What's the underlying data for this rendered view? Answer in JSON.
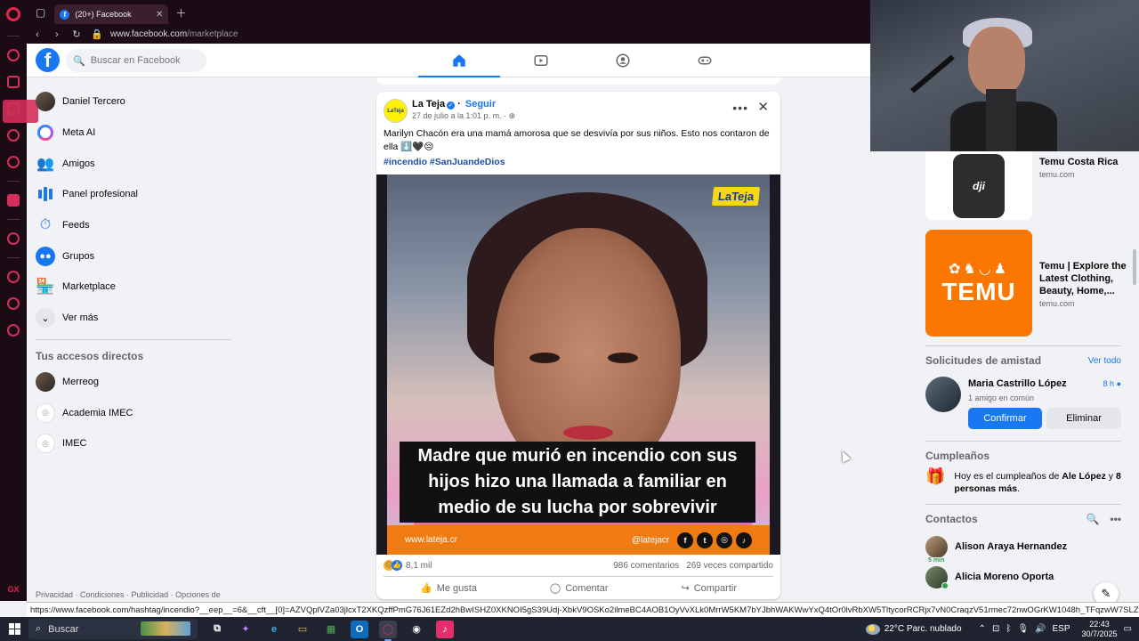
{
  "browser": {
    "tab_title": "(20+) Facebook",
    "url_host": "www.facebook.com",
    "url_path": "/marketplace",
    "status_url": "https://www.facebook.com/hashtag/incendio?__eep__=6&__cft__[0]=AZVQplVZa03jlcxT2XKQzffPmG76J61EZd2hBwISHZ0XKNOI5gS39Udj-XbkV9OSKo2ilmeBC4AOB1OyVvXLk0MrrW5KM7bYJbhWAKWwYxQ4tOr0lvRbXW5TltycorRCRjx7vN0CraqzV51rmec72nwOGrKW1048h_TFqzwW7SLZygS7nXpR..."
  },
  "header": {
    "logo": "f",
    "search_placeholder": "Buscar en Facebook"
  },
  "sidebar": {
    "items": [
      {
        "label": "Daniel Tercero"
      },
      {
        "label": "Meta AI"
      },
      {
        "label": "Amigos"
      },
      {
        "label": "Panel profesional"
      },
      {
        "label": "Feeds"
      },
      {
        "label": "Grupos"
      },
      {
        "label": "Marketplace"
      },
      {
        "label": "Ver más"
      }
    ],
    "shortcuts_title": "Tus accesos directos",
    "shortcuts": [
      {
        "label": "Merreog"
      },
      {
        "label": "Academia IMEC"
      },
      {
        "label": "IMEC"
      }
    ],
    "footer": "Privacidad · Condiciones · Publicidad · Opciones de"
  },
  "post": {
    "page_name": "La Teja",
    "follow": "Seguir",
    "date": "27 de julio a la 1:01 p. m. ·",
    "text": "Marilyn Chacón era una mamá amorosa que se desvivía por sus niños. Esto nos contaron de ella ⬇️🖤😔",
    "hashtags": "#incendio #SanJuandeDios",
    "image": {
      "brand": "LaTeja",
      "caption": "Madre que murió en incendio con sus hijos hizo una llamada a familiar en medio de su lucha por sobrevivir",
      "site": "www.lateja.cr",
      "handle": "@latejacr"
    },
    "reactions_count": "8,1 mil",
    "comments": "986 comentarios",
    "shares": "269 veces compartido",
    "actions": {
      "like": "Me gusta",
      "comment": "Comentar",
      "share": "Compartir"
    }
  },
  "right": {
    "ads": [
      {
        "title": "Temu Costa Rica",
        "domain": "temu.com"
      },
      {
        "title": "Temu | Explore the Latest Clothing, Beauty, Home,...",
        "domain": "temu.com"
      }
    ],
    "temu_logo": "TEMU",
    "dji_logo": "dji",
    "friend_requests": {
      "title": "Solicitudes de amistad",
      "see_all": "Ver todo",
      "name": "Maria Castrillo López",
      "time": "8 h",
      "mutual": "1 amigo en común",
      "confirm": "Confirmar",
      "delete": "Eliminar"
    },
    "birthdays": {
      "title": "Cumpleaños",
      "pre": "Hoy es el cumpleaños de ",
      "name": "Ale López",
      "mid": " y ",
      "others": "8 personas más",
      "post": "."
    },
    "contacts": {
      "title": "Contactos",
      "items": [
        {
          "name": "Alison Araya Hernandez",
          "badge": "5 min"
        },
        {
          "name": "Alicia Moreno Oporta",
          "badge": ""
        }
      ]
    }
  },
  "taskbar": {
    "search": "Buscar",
    "weather": "22°C  Parc. nublado",
    "lang": "ESP",
    "time": "22:43",
    "date": "30/7/2025"
  }
}
